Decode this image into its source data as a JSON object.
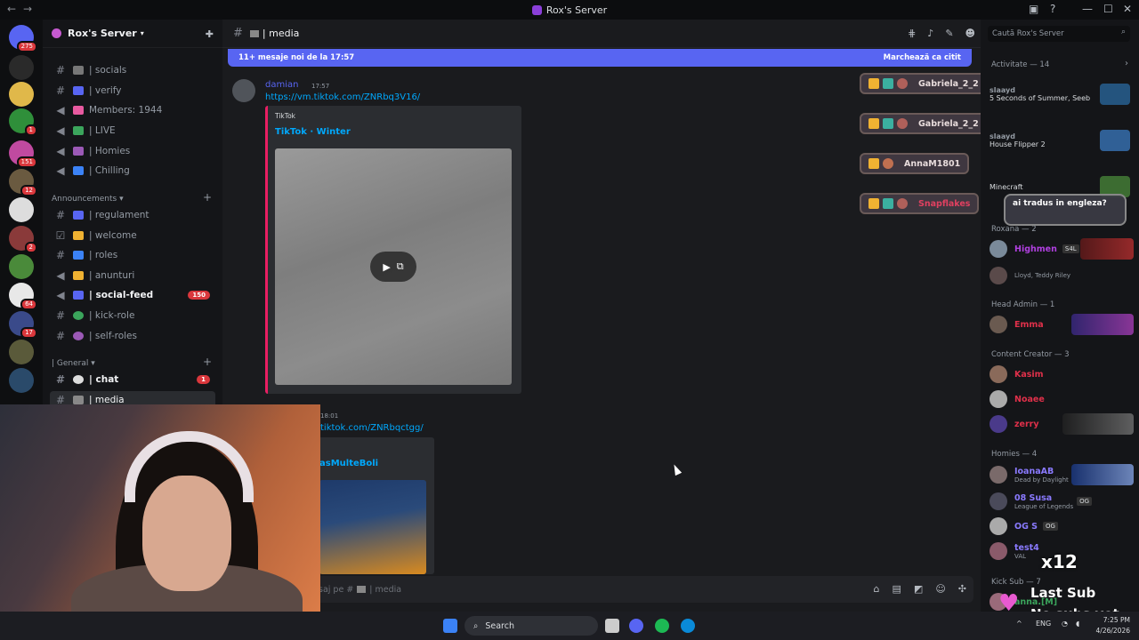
{
  "window": {
    "title": "Rox's Server"
  },
  "servers": [
    {
      "badge": "275"
    },
    {
      "badge": ""
    },
    {
      "badge": ""
    },
    {
      "badge": "1"
    },
    {
      "badge": "151"
    },
    {
      "badge": "12"
    },
    {
      "badge": ""
    },
    {
      "badge": "2"
    },
    {
      "badge": ""
    },
    {
      "badge": "64"
    },
    {
      "badge": "17"
    },
    {
      "badge": ""
    },
    {
      "badge": ""
    },
    {
      "badge": ""
    }
  ],
  "server": {
    "name": "Rox's Server"
  },
  "channels": {
    "top": [
      {
        "label": "| socials"
      },
      {
        "label": "| verify"
      },
      {
        "label": "Members: 1944"
      },
      {
        "label": "| LIVE"
      },
      {
        "label": "| Homies"
      },
      {
        "label": "| Chilling"
      }
    ],
    "announcements_label": "Announcements",
    "announcements": [
      {
        "label": "| regulament"
      },
      {
        "label": "| welcome"
      },
      {
        "label": "| roles"
      },
      {
        "label": "| anunturi"
      },
      {
        "label": "| social-feed",
        "badge": "150"
      },
      {
        "label": "| kick-role"
      },
      {
        "label": "| self-roles"
      }
    ],
    "general_label": "| General",
    "general": [
      {
        "label": "| chat",
        "badge": "1"
      },
      {
        "label": "| media"
      }
    ]
  },
  "main": {
    "channel_title": "| media",
    "new_messages": "11+ mesaje noi de la 17:57",
    "mark_read": "Marchează ca citit",
    "msg1": {
      "author": "damian",
      "time": "17:57",
      "link": "https://vm.tiktok.com/ZNRbq3V16/",
      "provider": "TikTok",
      "embed_title": "TikTok · Winter"
    },
    "msg2": {
      "time": "18:01",
      "link": "tiktok.com/ZNRbqctgg/",
      "embed_title": "asMulteBoli"
    },
    "composer_placeholder": "saj pe #",
    "composer_channel": "| media"
  },
  "members": {
    "search_placeholder": "Caută Rox's Server",
    "activity_label": "Activitate — 14",
    "activity": [
      {
        "name": "slaayd",
        "sub": "5 Seconds of Summer, Seeb"
      },
      {
        "name": "slaayd",
        "sub": "House Flipper 2"
      },
      {
        "name": "",
        "sub": "Minecraft"
      }
    ],
    "roxana_label": "Roxana — 2",
    "roxana": [
      {
        "name": "Highmen",
        "sub": "",
        "tag": "S4L"
      },
      {
        "name": "",
        "sub": "Lloyd, Teddy Riley"
      }
    ],
    "head_admin_label": "Head Admin — 1",
    "head_admin": [
      {
        "name": "Emma"
      }
    ],
    "content_creator_label": "Content Creator — 3",
    "content_creator": [
      {
        "name": "Kasim"
      },
      {
        "name": "Noaee"
      },
      {
        "name": "zerry"
      }
    ],
    "homies_label": "Homies — 4",
    "homies": [
      {
        "name": "IoanaAB",
        "sub": "Dead by Daylight"
      },
      {
        "name": "08 Susa",
        "sub": "League of Legends",
        "tag": "OG"
      },
      {
        "name": "OG S",
        "sub": "",
        "tag": "OG"
      },
      {
        "name": "test4",
        "sub": "VAL"
      }
    ],
    "kick_sub_label": "Kick Sub — 7",
    "kick_sub": [
      {
        "name": "anna.[M]"
      }
    ]
  },
  "toasts": [
    {
      "name": "Gabriela_2_2"
    },
    {
      "name": "Gabriela_2_2"
    },
    {
      "name": "AnnaM1801"
    },
    {
      "name": "Snapflakes"
    }
  ],
  "chat_bubble": "ai tradus in engleza?",
  "overlay": {
    "line1": "Last Sub",
    "line2": "No subs yet",
    "multiplier": "x12"
  },
  "taskbar": {
    "search": "Search",
    "lang": "ENG",
    "time": "7:25 PM",
    "date": "4/26/2026"
  }
}
